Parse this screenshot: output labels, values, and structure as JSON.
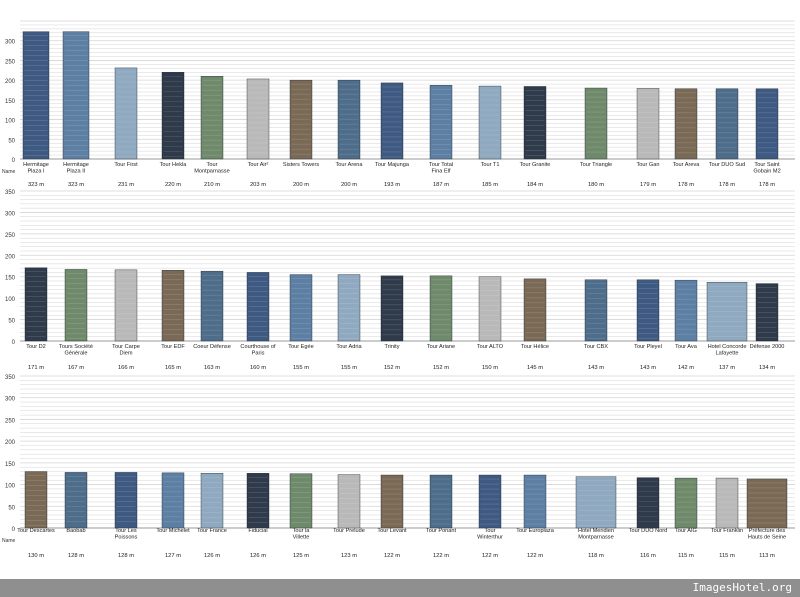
{
  "footer": {
    "watermark": "ImagesHotel.org"
  },
  "colors": {
    "background": "#ffffff",
    "gridline": "#d4d4d4",
    "baseline": "#9a9a9a",
    "footer": "#8f8f8f",
    "text": "#222222"
  },
  "chart_data": [
    {
      "type": "bar",
      "y_axis_label": "Name",
      "ylim": [
        0,
        350
      ],
      "yticks": [
        0,
        50,
        100,
        150,
        200,
        250,
        300
      ],
      "grid": true,
      "categories": [
        "Hermitage Plaza I",
        "Hermitage Plaza II",
        "Tour First",
        "Tour Hekla",
        "Tour Montparnasse",
        "Tour Air²",
        "Sisters Towers",
        "Tour Arena",
        "Tour Majunga",
        "Tour Total Fina Elf",
        "Tour T1",
        "Tour Granite",
        "Tour Triangle",
        "Tour Gan",
        "Tour Areva",
        "Tour DUO Sud",
        "Tour Saint Gobain M2"
      ],
      "values": [
        323,
        323,
        231,
        220,
        210,
        203,
        200,
        200,
        193,
        187,
        185,
        184,
        180,
        179,
        178,
        178,
        178
      ],
      "value_labels": [
        "323 m",
        "323 m",
        "231 m",
        "220 m",
        "210 m",
        "203 m",
        "200 m",
        "200 m",
        "193 m",
        "187 m",
        "185 m",
        "184 m",
        "180 m",
        "179 m",
        "178 m",
        "178 m",
        "178 m"
      ]
    },
    {
      "type": "bar",
      "y_axis_label": "",
      "ylim": [
        0,
        350
      ],
      "yticks": [
        0,
        50,
        100,
        150,
        200,
        250,
        300,
        350
      ],
      "grid": true,
      "categories": [
        "Tour D2",
        "Tours Société Générale",
        "Tour Carpe Diem",
        "Tour EDF",
        "Coeur Défense",
        "Courthouse of Paris",
        "Tour Egée",
        "Tour Adria",
        "Trinity",
        "Tour Ariane",
        "Tour ALTO",
        "Tour Hélice",
        "Tour CBX",
        "Tour Pleyel",
        "Tour Ava",
        "Hotel Concorde Lafayette",
        "Défense 2000"
      ],
      "values": [
        171,
        167,
        166,
        165,
        163,
        160,
        155,
        155,
        152,
        152,
        150,
        145,
        143,
        143,
        142,
        137,
        134
      ],
      "value_labels": [
        "171 m",
        "167 m",
        "166 m",
        "165 m",
        "163 m",
        "160 m",
        "155 m",
        "155 m",
        "152 m",
        "152 m",
        "150 m",
        "145 m",
        "143 m",
        "143 m",
        "142 m",
        "137 m",
        "134 m"
      ]
    },
    {
      "type": "bar",
      "y_axis_label": "Name",
      "ylim": [
        0,
        350
      ],
      "yticks": [
        0,
        50,
        100,
        150,
        200,
        250,
        300,
        350
      ],
      "grid": true,
      "categories": [
        "Tour Descartes",
        "Baobab",
        "Tour Les Poissons",
        "Tour Michelet",
        "Tour France",
        "Fiducial",
        "Tour la Villette",
        "Tour Prelude",
        "Tour Levant",
        "Tour Ponant",
        "Tour Winterthur",
        "Tour Europlaza",
        "Hotel Meridien Montparnasse",
        "Tour DUO Nord",
        "Tour AIG",
        "Tour Franklin",
        "Préfecture des Hauts de Seine"
      ],
      "values": [
        130,
        128,
        128,
        127,
        126,
        126,
        125,
        123,
        122,
        122,
        122,
        122,
        118,
        116,
        115,
        115,
        113
      ],
      "value_labels": [
        "130 m",
        "128 m",
        "128 m",
        "127 m",
        "126 m",
        "126 m",
        "125 m",
        "123 m",
        "122 m",
        "122 m",
        "122 m",
        "122 m",
        "118 m",
        "116 m",
        "115 m",
        "115 m",
        "113 m"
      ]
    }
  ]
}
